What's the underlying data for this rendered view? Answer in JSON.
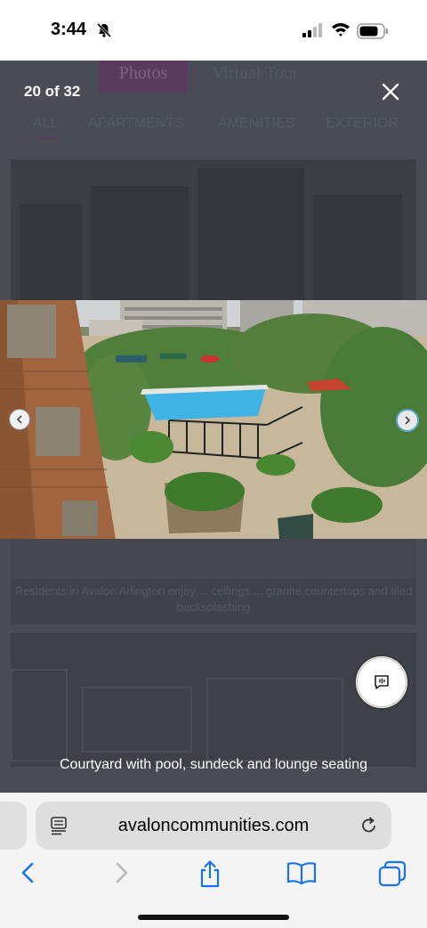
{
  "status_bar": {
    "time": "3:44"
  },
  "background_page": {
    "tabs": [
      "Photos",
      "Virtual Tour"
    ],
    "filters": [
      "ALL",
      "APARTMENTS",
      "AMENITIES",
      "EXTERIOR"
    ],
    "blurred_caption": "Residents in Avalon Arlington enjoy ... ceilings ... granite countertops and tiled backsplashing"
  },
  "lightbox": {
    "counter": "20 of 32",
    "caption": "Courtyard with pool, sundeck and lounge seating"
  },
  "browser": {
    "url": "avaloncommunities.com"
  },
  "colors": {
    "overlay": "#4a4c55",
    "accent": "#5fa7c9",
    "safari_blue": "#1a73e8"
  }
}
